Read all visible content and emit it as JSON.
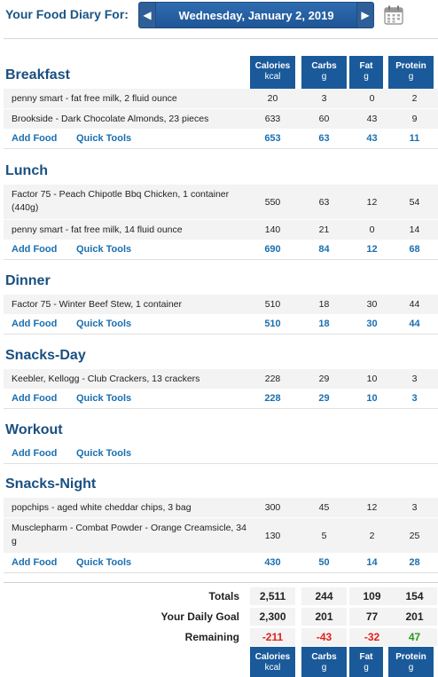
{
  "header": {
    "label": "Your Food Diary For:",
    "date": "Wednesday, January 2, 2019"
  },
  "columns": [
    {
      "name": "Calories",
      "unit": "kcal"
    },
    {
      "name": "Carbs",
      "unit": "g"
    },
    {
      "name": "Fat",
      "unit": "g"
    },
    {
      "name": "Protein",
      "unit": "g"
    }
  ],
  "actions": {
    "add_food": "Add Food",
    "quick_tools": "Quick Tools"
  },
  "meals": [
    {
      "title": "Breakfast",
      "items": [
        {
          "name": "penny smart - fat free milk, 2 fluid ounce",
          "cal": "20",
          "carbs": "3",
          "fat": "0",
          "protein": "2"
        },
        {
          "name": "Brookside - Dark Chocolate Almonds, 23 pieces",
          "cal": "633",
          "carbs": "60",
          "fat": "43",
          "protein": "9"
        }
      ],
      "totals": {
        "cal": "653",
        "carbs": "63",
        "fat": "43",
        "protein": "11"
      }
    },
    {
      "title": "Lunch",
      "items": [
        {
          "name": "Factor 75 - Peach Chipotle Bbq Chicken, 1 container (440g)",
          "cal": "550",
          "carbs": "63",
          "fat": "12",
          "protein": "54"
        },
        {
          "name": "penny smart - fat free milk, 14 fluid ounce",
          "cal": "140",
          "carbs": "21",
          "fat": "0",
          "protein": "14"
        }
      ],
      "totals": {
        "cal": "690",
        "carbs": "84",
        "fat": "12",
        "protein": "68"
      }
    },
    {
      "title": "Dinner",
      "items": [
        {
          "name": "Factor 75 - Winter Beef Stew, 1 container",
          "cal": "510",
          "carbs": "18",
          "fat": "30",
          "protein": "44"
        }
      ],
      "totals": {
        "cal": "510",
        "carbs": "18",
        "fat": "30",
        "protein": "44"
      }
    },
    {
      "title": "Snacks-Day",
      "items": [
        {
          "name": "Keebler, Kellogg - Club Crackers, 13 crackers",
          "cal": "228",
          "carbs": "29",
          "fat": "10",
          "protein": "3"
        }
      ],
      "totals": {
        "cal": "228",
        "carbs": "29",
        "fat": "10",
        "protein": "3"
      }
    },
    {
      "title": "Workout",
      "items": [],
      "totals": {
        "cal": "",
        "carbs": "",
        "fat": "",
        "protein": ""
      }
    },
    {
      "title": "Snacks-Night",
      "items": [
        {
          "name": "popchips - aged white cheddar chips, 3 bag",
          "cal": "300",
          "carbs": "45",
          "fat": "12",
          "protein": "3"
        },
        {
          "name": "Musclepharm - Combat Powder - Orange Creamsicle, 34 g",
          "cal": "130",
          "carbs": "5",
          "fat": "2",
          "protein": "25"
        }
      ],
      "totals": {
        "cal": "430",
        "carbs": "50",
        "fat": "14",
        "protein": "28"
      }
    }
  ],
  "summary": {
    "totals": {
      "label": "Totals",
      "cal": "2,511",
      "carbs": "244",
      "fat": "109",
      "protein": "154"
    },
    "goal": {
      "label": "Your Daily Goal",
      "cal": "2,300",
      "carbs": "201",
      "fat": "77",
      "protein": "201"
    },
    "remaining": {
      "label": "Remaining",
      "cal": "-211",
      "carbs": "-43",
      "fat": "-32",
      "protein": "47"
    }
  },
  "colors": {
    "header_blue": "#1a5a9a",
    "title_blue": "#1a4f80",
    "link_blue": "#1a6fb0",
    "negative": "#e0201a",
    "positive": "#2b9a1f"
  }
}
